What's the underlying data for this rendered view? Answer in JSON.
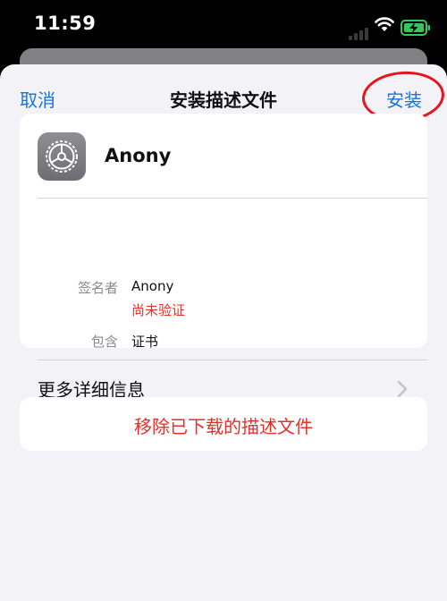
{
  "status_bar": {
    "time": "11:59"
  },
  "nav": {
    "cancel": "取消",
    "title": "安装描述文件",
    "install": "安装"
  },
  "profile": {
    "name": "Anony",
    "signer_label": "签名者",
    "signer_value": "Anony",
    "signer_status": "尚未验证",
    "contains_label": "包含",
    "contains_value": "证书",
    "more_details": "更多详细信息"
  },
  "remove_button": "移除已下载的描述文件",
  "colors": {
    "accent": "#1a73d9",
    "destructive": "#e5302a",
    "annotation_circle": "#e8141c",
    "battery_charging": "#34c759"
  },
  "icons": [
    "signal-icon",
    "wifi-icon",
    "battery-charging-icon",
    "settings-gear-icon",
    "chevron-right-icon"
  ]
}
